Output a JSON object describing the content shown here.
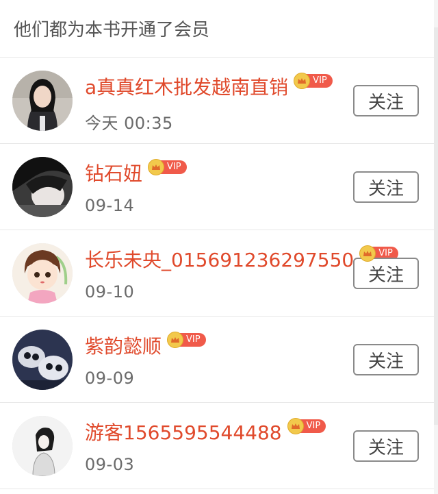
{
  "header": {
    "title": "他们都为本书开通了会员"
  },
  "vip_label": "VIP",
  "follow_label": "关注",
  "colors": {
    "name": "#e04a2c",
    "vip_tag": "#f05a4a",
    "crown": "#f2c94c"
  },
  "members": [
    {
      "name": "a真真红木批发越南直销",
      "date": "今天 00:35",
      "avatar": "girl-photo"
    },
    {
      "name": "钻石妞",
      "date": "09-14",
      "avatar": "dark-hair-photo"
    },
    {
      "name": "长乐未央_015691236297550",
      "date": "09-10",
      "avatar": "cartoon-girl"
    },
    {
      "name": "紫韵懿顺",
      "date": "09-09",
      "avatar": "panda-puppies"
    },
    {
      "name": "游客1565595544488",
      "date": "09-03",
      "avatar": "sketch-girl"
    }
  ]
}
